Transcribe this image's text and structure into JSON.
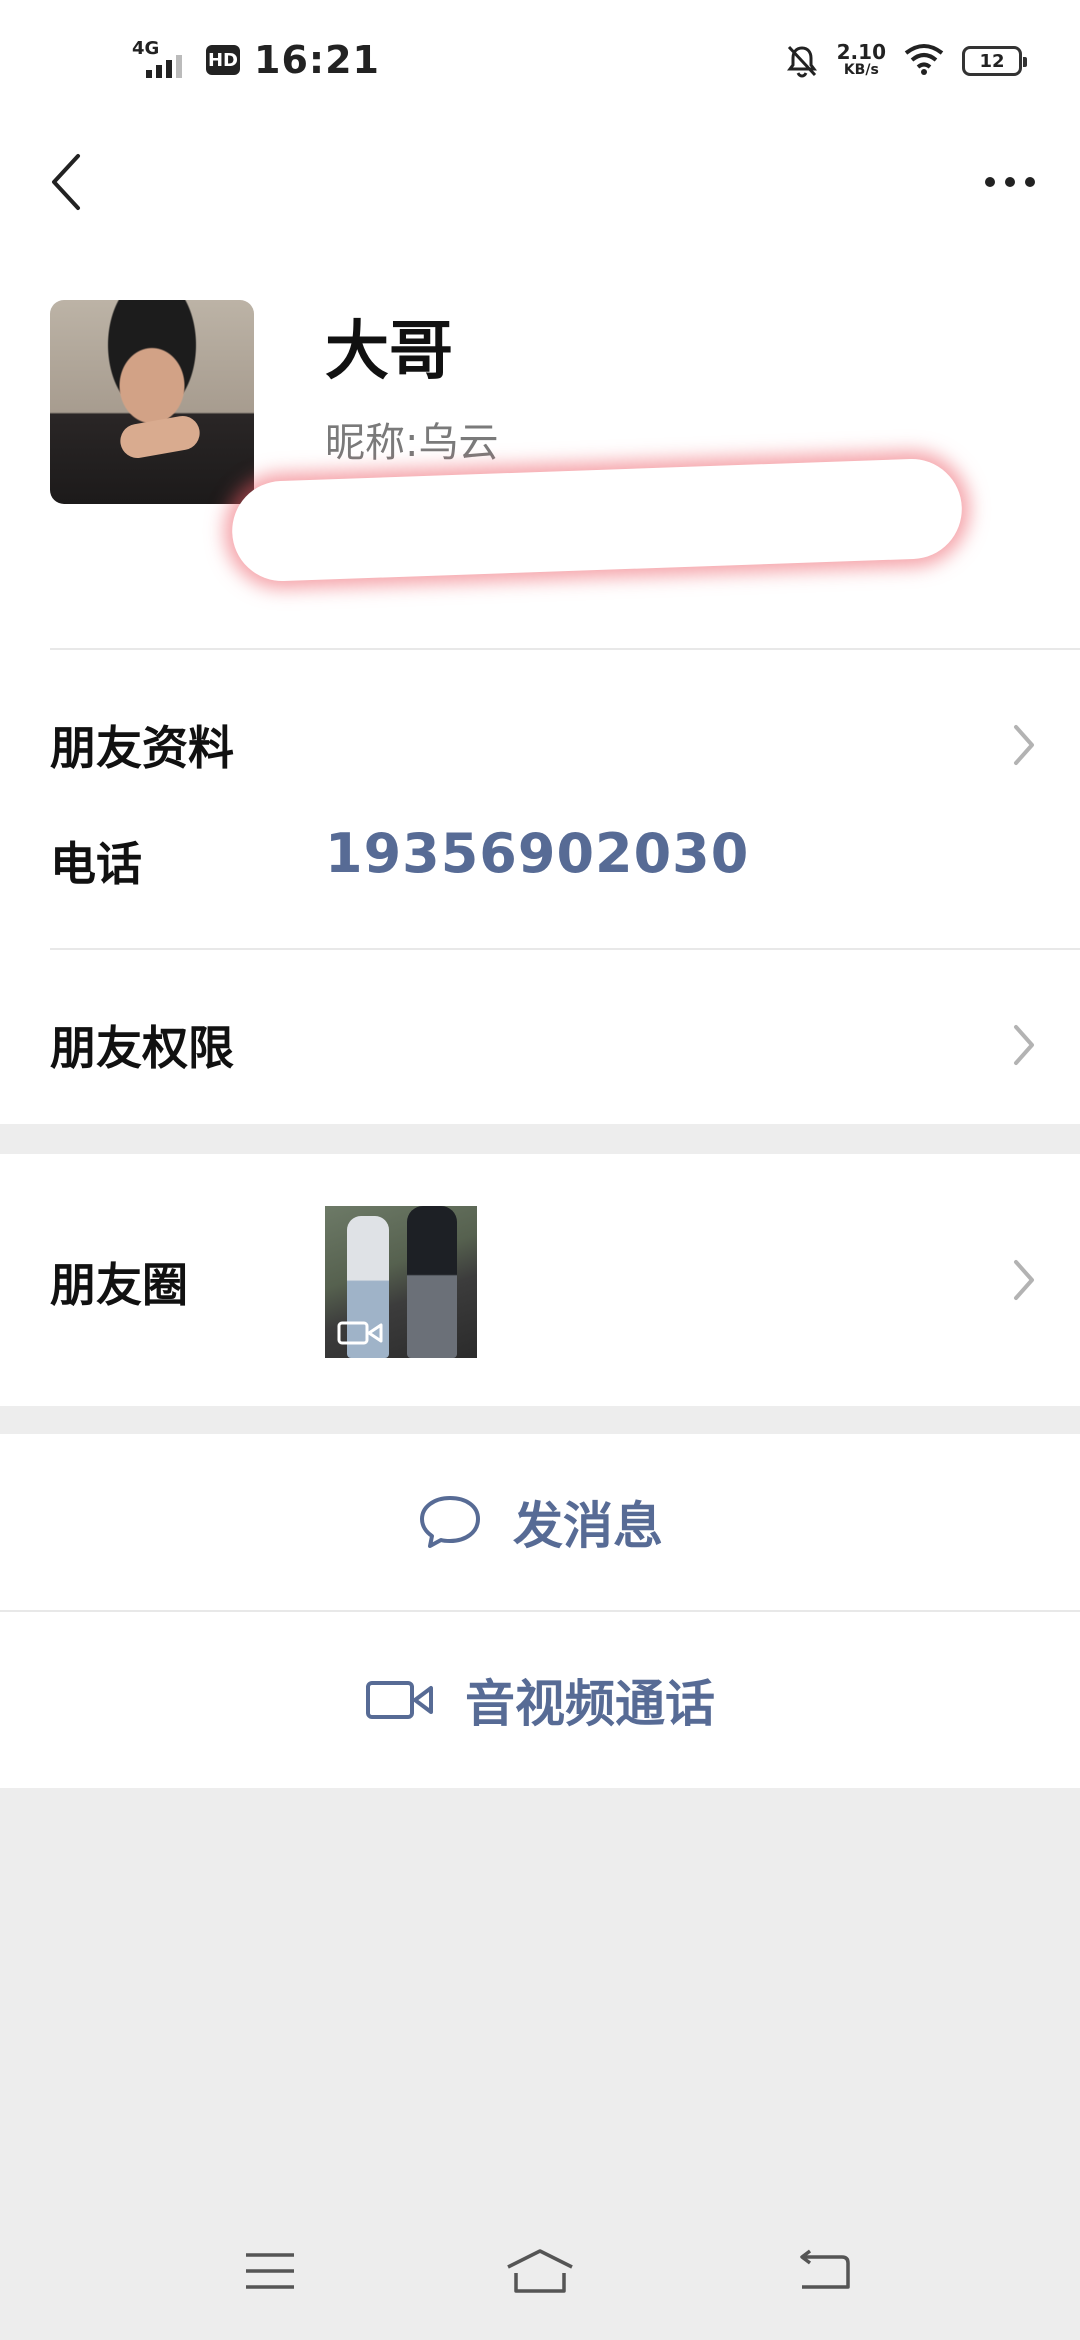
{
  "status_bar": {
    "network": "4G",
    "hd": "HD",
    "time": "16:21",
    "speed_value": "2.10",
    "speed_unit": "KB/s",
    "battery": "12"
  },
  "nav": {
    "back_icon": "chevron-left-icon",
    "more_icon": "more-dots-icon"
  },
  "profile": {
    "name": "大哥",
    "nickname_label": "昵称:",
    "nickname_value": "乌云"
  },
  "rows": {
    "friend_info": "朋友资料",
    "phone_label": "电话",
    "phone_value": "19356902030",
    "friend_permissions": "朋友权限",
    "moments": "朋友圈"
  },
  "actions": {
    "send_message": "发消息",
    "video_call": "音视频通话"
  },
  "colors": {
    "link_blue": "#576b95",
    "background": "#ededed"
  }
}
